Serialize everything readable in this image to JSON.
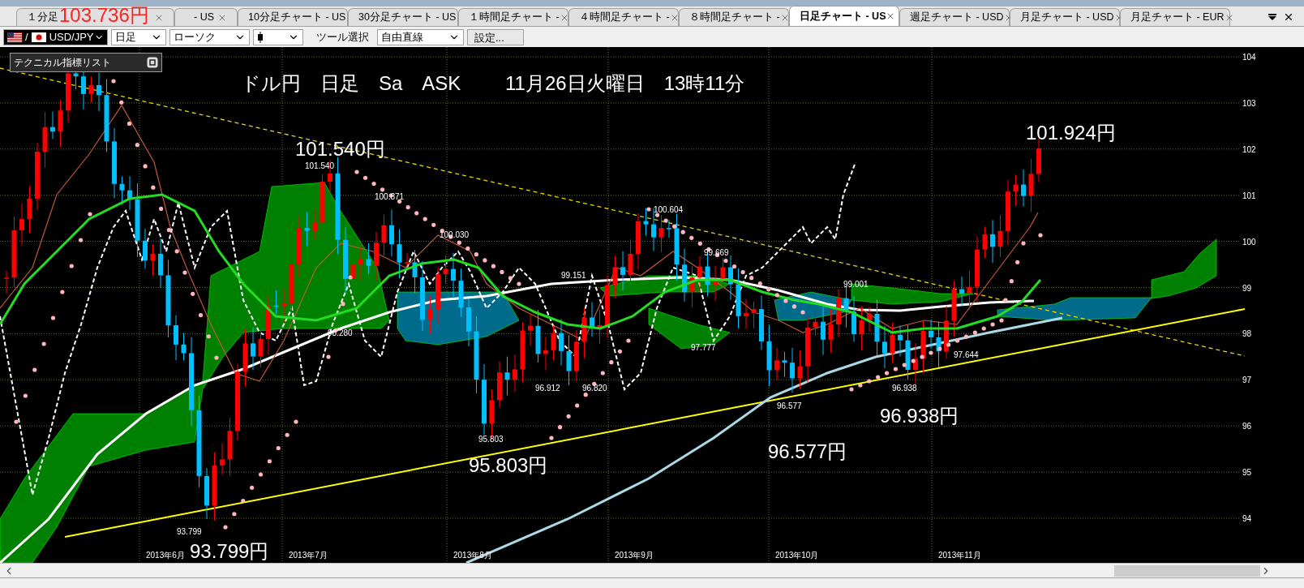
{
  "overlay_price": "103.736円",
  "tabs": [
    {
      "label": "１分足",
      "selected": false
    },
    {
      "label": "- US",
      "selected": false
    },
    {
      "label": "10分足チャート - US",
      "selected": false
    },
    {
      "label": "30分足チャート - US",
      "selected": false
    },
    {
      "label": "１時間足チャート -",
      "selected": false
    },
    {
      "label": "４時間足チャート -",
      "selected": false
    },
    {
      "label": "８時間足チャート -",
      "selected": false
    },
    {
      "label": "日足チャート - US",
      "selected": true
    },
    {
      "label": "週足チャート - USD",
      "selected": false
    },
    {
      "label": "月足チャート - USD",
      "selected": false
    },
    {
      "label": "月足チャート - EUR",
      "selected": false
    }
  ],
  "toolbar": {
    "flag_separator": "/",
    "symbol": "USD/JPY",
    "timeframe": "日足",
    "chart_type": "ローソク",
    "tool_label": "ツール選択",
    "tool": "自由直線",
    "settings_button": "設定..."
  },
  "indicator_panel": {
    "title": "テクニカル指標リスト"
  },
  "chart": {
    "title": "ドル円　日足　Sa　ASK　　 11月26日火曜日　13時11分",
    "callouts": [
      {
        "text": "101.540円",
        "kind": "big"
      },
      {
        "text": "101.924円",
        "kind": "big"
      },
      {
        "text": "95.803円",
        "kind": "big"
      },
      {
        "text": "93.799円",
        "kind": "big"
      },
      {
        "text": "96.577円",
        "kind": "big"
      },
      {
        "text": "96.938円",
        "kind": "big"
      },
      {
        "text": "101.540",
        "kind": "small"
      },
      {
        "text": "100.871",
        "kind": "small"
      },
      {
        "text": "100.030",
        "kind": "small"
      },
      {
        "text": "99.151",
        "kind": "small"
      },
      {
        "text": "98.280",
        "kind": "small"
      },
      {
        "text": "96.912",
        "kind": "small"
      },
      {
        "text": "96.820",
        "kind": "small"
      },
      {
        "text": "95.803",
        "kind": "small"
      },
      {
        "text": "93.799",
        "kind": "small"
      },
      {
        "text": "100.604",
        "kind": "small"
      },
      {
        "text": "99.669",
        "kind": "small"
      },
      {
        "text": "97.777",
        "kind": "small"
      },
      {
        "text": "99.001",
        "kind": "small"
      },
      {
        "text": "97.644",
        "kind": "small"
      },
      {
        "text": "96.938",
        "kind": "small"
      },
      {
        "text": "96.577",
        "kind": "small"
      }
    ],
    "y_axis": [
      "104",
      "103",
      "102",
      "101",
      "100",
      "99",
      "98",
      "97",
      "96",
      "95",
      "94"
    ],
    "x_axis": [
      "2013年6月",
      "2013年7月",
      "2013年8月",
      "2013年9月",
      "2013年10月",
      "2013年11月"
    ]
  }
}
